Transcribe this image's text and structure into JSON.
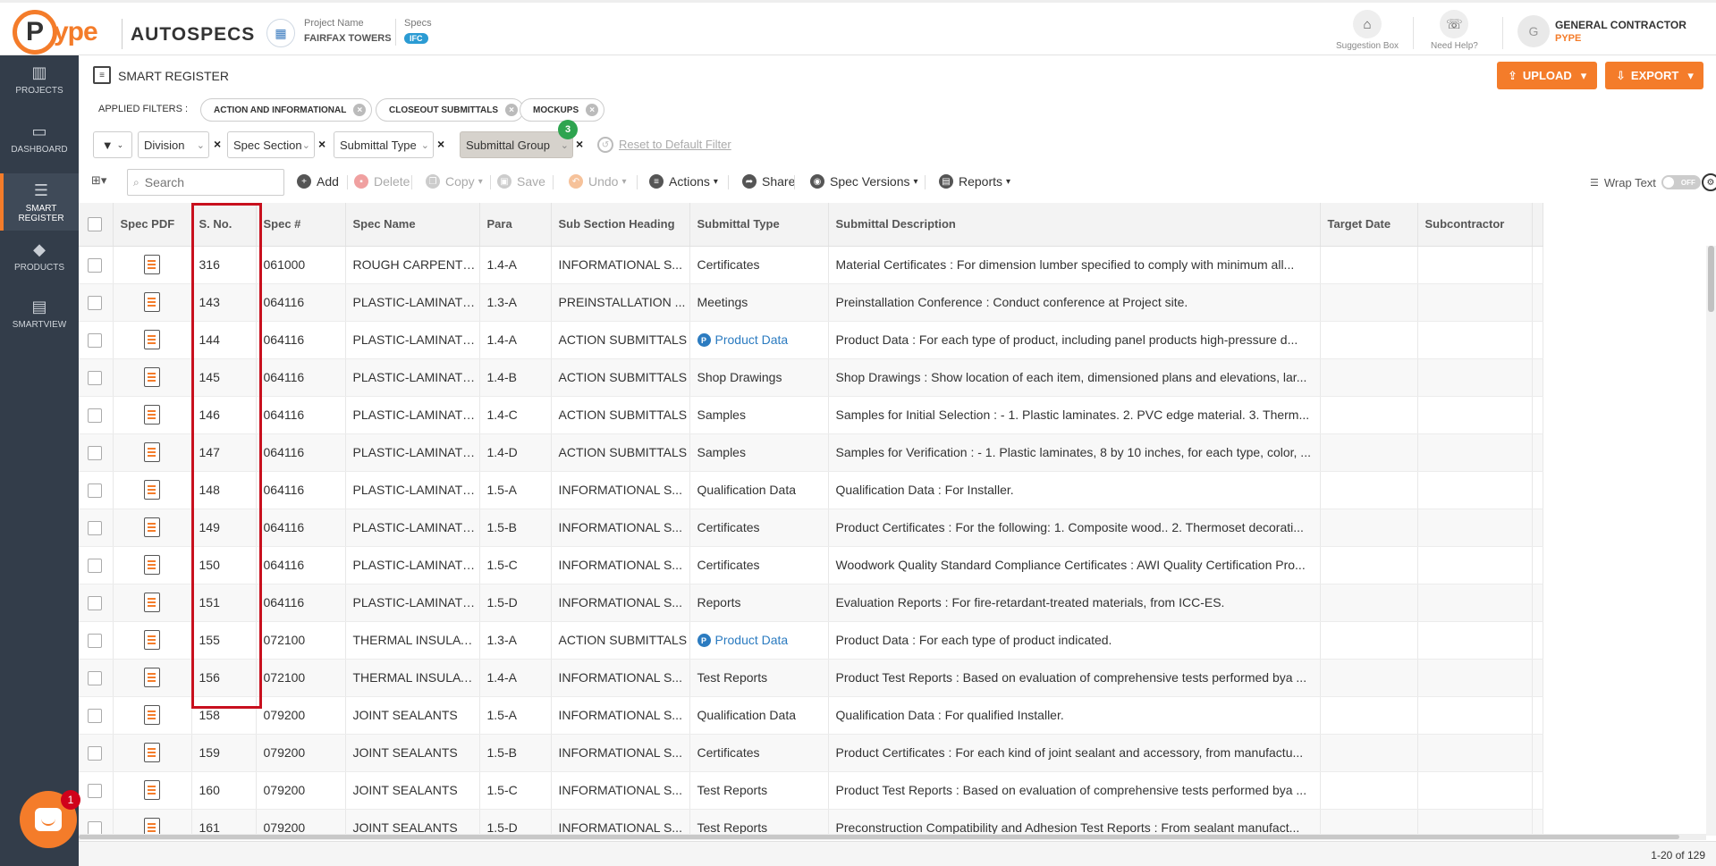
{
  "header": {
    "logo_mark": "P",
    "logo_text": "ype",
    "product": "AUTOSPECS",
    "project_label": "Project Name",
    "project_value": "FAIRFAX TOWERS",
    "specs_label": "Specs",
    "specs_badge": "IFC",
    "suggestion_label": "Suggestion Box",
    "help_label": "Need Help?",
    "avatar_initial": "G",
    "user_role": "GENERAL CONTRACTOR",
    "user_company": "PYPE"
  },
  "sidebar": {
    "items": [
      {
        "label": "PROJECTS",
        "icon": "building-icon"
      },
      {
        "label": "DASHBOARD",
        "icon": "monitor-icon"
      },
      {
        "label": "SMART REGISTER",
        "icon": "register-icon"
      },
      {
        "label": "PRODUCTS",
        "icon": "tag-icon"
      },
      {
        "label": "SMARTVIEW",
        "icon": "smartview-icon"
      }
    ]
  },
  "titlebar": {
    "title": "SMART REGISTER",
    "upload_label": "UPLOAD",
    "export_label": "EXPORT"
  },
  "filters": {
    "label": "APPLIED FILTERS :",
    "chips": [
      "ACTION AND INFORMATIONAL",
      "CLOSEOUT SUBMITTALS",
      "MOCKUPS"
    ]
  },
  "groupbar": {
    "dropdowns": [
      "Division",
      "Spec Section",
      "Submittal Type",
      "Submittal Group"
    ],
    "badge": "3",
    "reset_label": "Reset to Default Filter"
  },
  "toolbar": {
    "search_placeholder": "Search",
    "add": "Add",
    "delete": "Delete",
    "copy": "Copy",
    "save": "Save",
    "undo": "Undo",
    "actions": "Actions",
    "share": "Share",
    "spec_versions": "Spec Versions",
    "reports": "Reports",
    "wrap_text": "Wrap Text",
    "toggle_state": "OFF"
  },
  "table": {
    "columns": [
      "Spec PDF",
      "S. No.",
      "Spec #",
      "Spec Name",
      "Para",
      "Sub Section Heading",
      "Submittal Type",
      "Submittal Description",
      "Target Date",
      "Subcontractor"
    ],
    "rows": [
      {
        "sno": "316",
        "spec": "061000",
        "name": "ROUGH CARPENTRY",
        "para": "1.4-A",
        "heading": "INFORMATIONAL S...",
        "type": "Certificates",
        "type_link": false,
        "desc": "Material Certificates : For dimension lumber specified to comply with minimum all..."
      },
      {
        "sno": "143",
        "spec": "064116",
        "name": "PLASTIC-LAMINATE...",
        "para": "1.3-A",
        "heading": "PREINSTALLATION ...",
        "type": "Meetings",
        "type_link": false,
        "desc": "Preinstallation Conference : Conduct conference at Project site."
      },
      {
        "sno": "144",
        "spec": "064116",
        "name": "PLASTIC-LAMINATE...",
        "para": "1.4-A",
        "heading": "ACTION SUBMITTALS",
        "type": "Product Data",
        "type_link": true,
        "desc": "Product Data : For each type of product, including panel products high-pressure d..."
      },
      {
        "sno": "145",
        "spec": "064116",
        "name": "PLASTIC-LAMINATE...",
        "para": "1.4-B",
        "heading": "ACTION SUBMITTALS",
        "type": "Shop Drawings",
        "type_link": false,
        "desc": "Shop Drawings : Show location of each item, dimensioned plans and elevations, lar..."
      },
      {
        "sno": "146",
        "spec": "064116",
        "name": "PLASTIC-LAMINATE...",
        "para": "1.4-C",
        "heading": "ACTION SUBMITTALS",
        "type": "Samples",
        "type_link": false,
        "desc": "Samples for Initial Selection : - 1. Plastic laminates. 2. PVC edge material. 3. Therm..."
      },
      {
        "sno": "147",
        "spec": "064116",
        "name": "PLASTIC-LAMINATE...",
        "para": "1.4-D",
        "heading": "ACTION SUBMITTALS",
        "type": "Samples",
        "type_link": false,
        "desc": "Samples for Verification : - 1. Plastic laminates, 8 by 10 inches, for each type, color, ..."
      },
      {
        "sno": "148",
        "spec": "064116",
        "name": "PLASTIC-LAMINATE...",
        "para": "1.5-A",
        "heading": "INFORMATIONAL S...",
        "type": "Qualification Data",
        "type_link": false,
        "desc": "Qualification Data : For Installer."
      },
      {
        "sno": "149",
        "spec": "064116",
        "name": "PLASTIC-LAMINATE...",
        "para": "1.5-B",
        "heading": "INFORMATIONAL S...",
        "type": "Certificates",
        "type_link": false,
        "desc": "Product Certificates : For the following: 1. Composite wood.. 2. Thermoset decorati..."
      },
      {
        "sno": "150",
        "spec": "064116",
        "name": "PLASTIC-LAMINATE...",
        "para": "1.5-C",
        "heading": "INFORMATIONAL S...",
        "type": "Certificates",
        "type_link": false,
        "desc": "Woodwork Quality Standard Compliance Certificates : AWI Quality Certification Pro..."
      },
      {
        "sno": "151",
        "spec": "064116",
        "name": "PLASTIC-LAMINATE...",
        "para": "1.5-D",
        "heading": "INFORMATIONAL S...",
        "type": "Reports",
        "type_link": false,
        "desc": "Evaluation Reports : For fire-retardant-treated materials, from ICC-ES."
      },
      {
        "sno": "155",
        "spec": "072100",
        "name": "THERMAL INSULATI...",
        "para": "1.3-A",
        "heading": "ACTION SUBMITTALS",
        "type": "Product Data",
        "type_link": true,
        "desc": "Product Data : For each type of product indicated."
      },
      {
        "sno": "156",
        "spec": "072100",
        "name": "THERMAL INSULATI...",
        "para": "1.4-A",
        "heading": "INFORMATIONAL S...",
        "type": "Test Reports",
        "type_link": false,
        "desc": "Product Test Reports : Based on evaluation of comprehensive tests performed bya ..."
      },
      {
        "sno": "158",
        "spec": "079200",
        "name": "JOINT SEALANTS",
        "para": "1.5-A",
        "heading": "INFORMATIONAL S...",
        "type": "Qualification Data",
        "type_link": false,
        "desc": "Qualification Data : For qualified Installer."
      },
      {
        "sno": "159",
        "spec": "079200",
        "name": "JOINT SEALANTS",
        "para": "1.5-B",
        "heading": "INFORMATIONAL S...",
        "type": "Certificates",
        "type_link": false,
        "desc": "Product Certificates : For each kind of joint sealant and accessory, from manufactu..."
      },
      {
        "sno": "160",
        "spec": "079200",
        "name": "JOINT SEALANTS",
        "para": "1.5-C",
        "heading": "INFORMATIONAL S...",
        "type": "Test Reports",
        "type_link": false,
        "desc": "Product Test Reports : Based on evaluation of comprehensive tests performed bya ..."
      },
      {
        "sno": "161",
        "spec": "079200",
        "name": "JOINT SEALANTS",
        "para": "1.5-D",
        "heading": "INFORMATIONAL S...",
        "type": "Test Reports",
        "type_link": false,
        "desc": "Preconstruction Compatibility and Adhesion Test Reports : From sealant manufact..."
      }
    ]
  },
  "footer": {
    "pager": "1-20 of 129"
  },
  "chat": {
    "badge": "1"
  },
  "colors": {
    "accent": "#f47c2a",
    "sidebar": "#333d4a",
    "link": "#2b7bc0",
    "highlight": "#c8101e"
  }
}
